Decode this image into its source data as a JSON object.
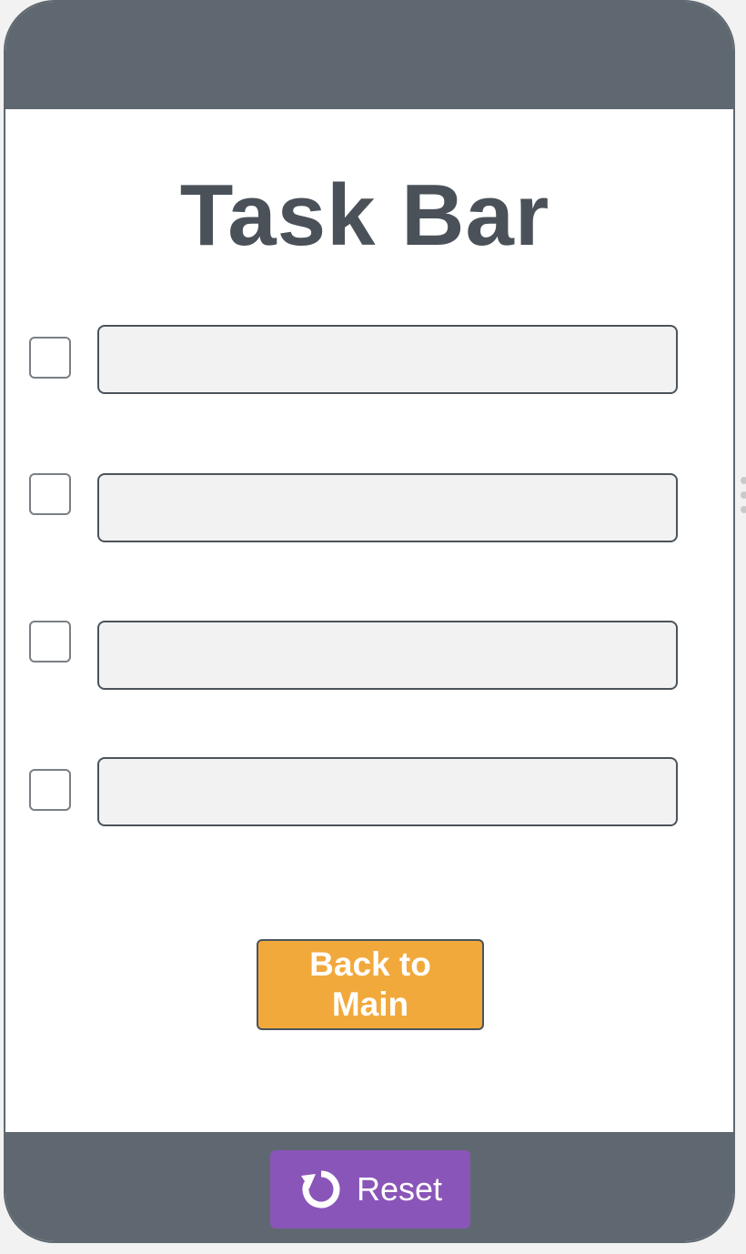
{
  "app": {
    "title": "Task Bar"
  },
  "tasks": [
    {
      "checked": false,
      "value": ""
    },
    {
      "checked": false,
      "value": ""
    },
    {
      "checked": false,
      "value": ""
    },
    {
      "checked": false,
      "value": ""
    }
  ],
  "buttons": {
    "back_label": "Back to Main",
    "reset_label": "Reset",
    "reset_icon": "refresh-icon"
  },
  "colors": {
    "frame": "#5f6870",
    "title_text": "#4a5159",
    "back_button": "#f2a93b",
    "reset_button": "#8a55b8",
    "input_bg": "#f2f2f2"
  }
}
